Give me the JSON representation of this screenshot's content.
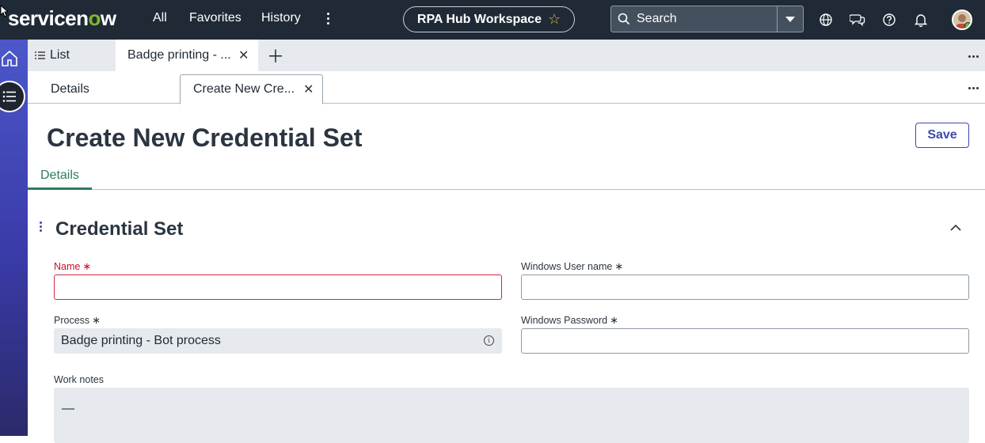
{
  "topnav": {
    "brand_prefix": "servicen",
    "brand_o": "o",
    "brand_suffix": "w",
    "links": [
      "All",
      "Favorites",
      "History"
    ],
    "workspace": "RPA Hub Workspace",
    "search_placeholder": "Search",
    "icons": [
      "globe-icon",
      "chat-icon",
      "help-icon",
      "bell-icon"
    ]
  },
  "tabs": {
    "list_label": "List",
    "record_tab": "Badge printing - ...",
    "details_tab": "Details",
    "new_tab": "Create New Cre..."
  },
  "page": {
    "title": "Create New Credential Set",
    "save_label": "Save",
    "subtab": "Details"
  },
  "section": {
    "title": "Credential Set"
  },
  "form": {
    "name_label": "Name",
    "name_value": "",
    "process_label": "Process",
    "process_value": "Badge printing - Bot process",
    "win_user_label": "Windows User name",
    "win_user_value": "",
    "win_pass_label": "Windows Password",
    "win_pass_value": "",
    "work_notes_label": "Work notes",
    "work_notes_value": "—",
    "required_mark": "∗"
  },
  "colors": {
    "topbar": "#1f2a36",
    "accent": "#3c4aa8",
    "error": "#c8102e",
    "tab_green": "#2e7d5b"
  }
}
